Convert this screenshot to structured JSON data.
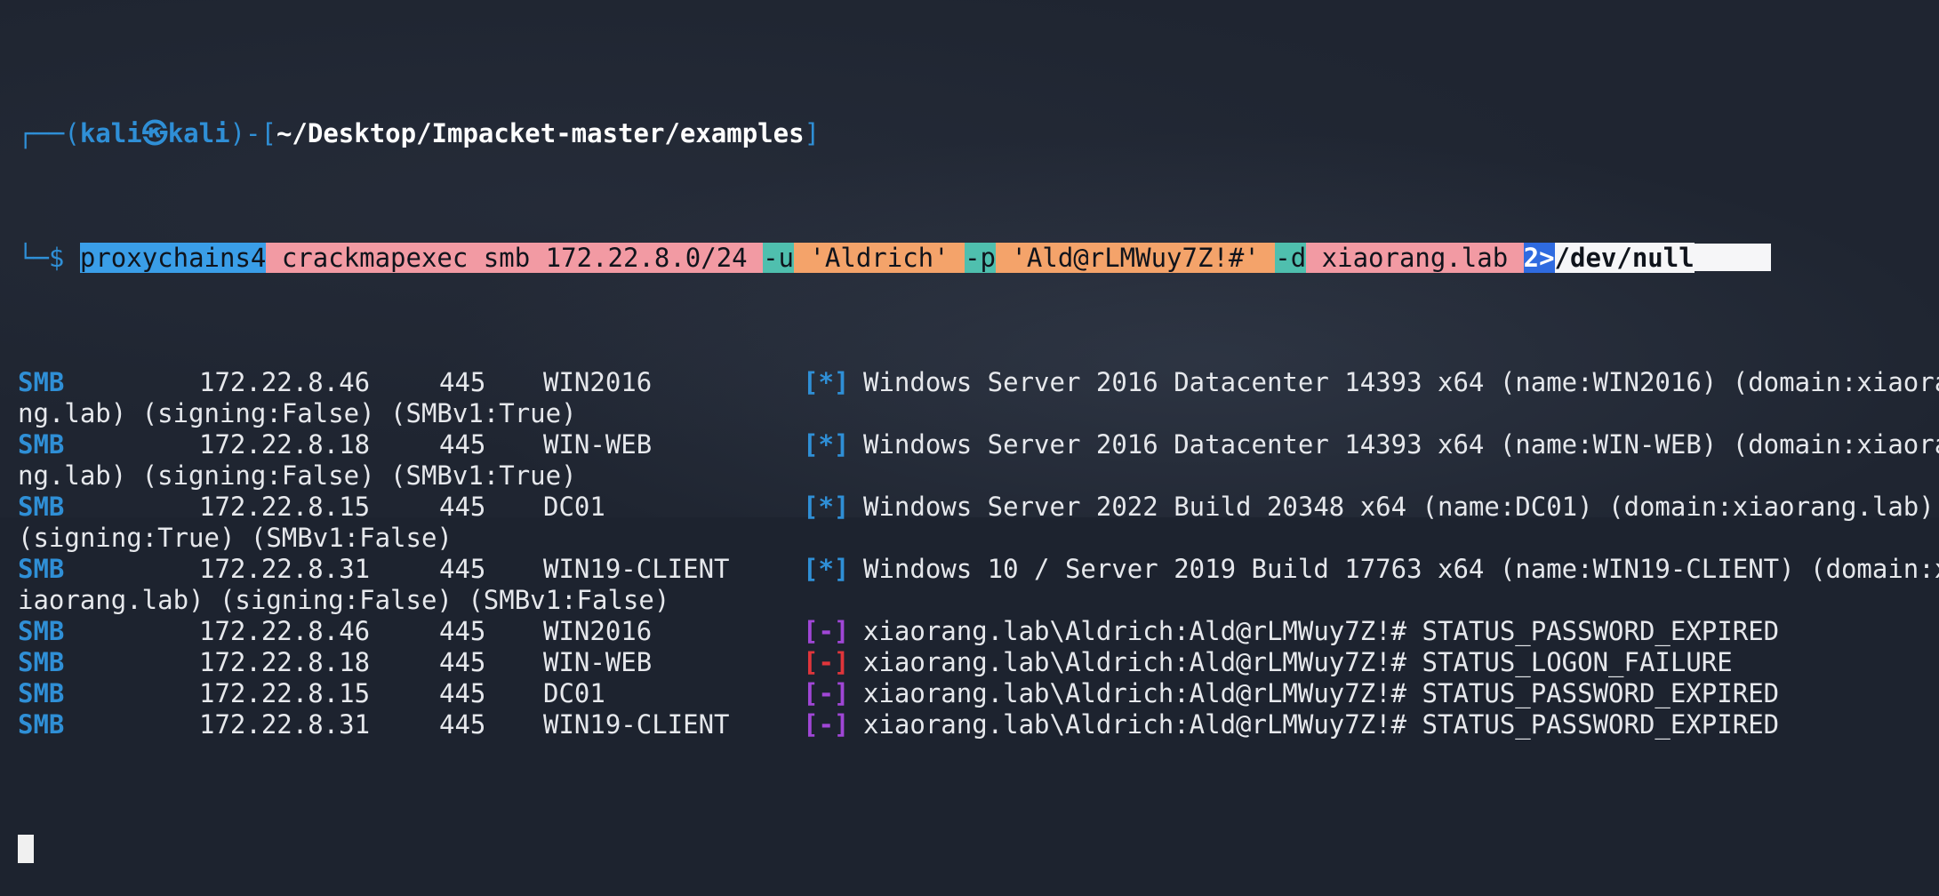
{
  "prompt": {
    "frame_left": "┌──(",
    "user": "kali",
    "at_glyph": "㉿",
    "host": "kali",
    "frame_mid": ")-[",
    "cwd": "~/Desktop/Impacket-master/examples",
    "frame_right": "]",
    "frame_bottom": "└─",
    "dollar": "$"
  },
  "command": {
    "cmd": "proxychains4",
    "arg1": " crackmapexec smb 172.22.8.0/24 ",
    "flag_u": "-u",
    "user_val": " 'Aldrich' ",
    "flag_p": "-p",
    "pass_val": " 'Ald@rLMWuy7Z!#' ",
    "flag_d": "-d",
    "domain_val": " xiaorang.lab ",
    "redir": "2>",
    "devnull": "/dev/null"
  },
  "output": [
    {
      "proto": "SMB",
      "ip": "172.22.8.46",
      "port": "445",
      "host": "WIN2016",
      "tag": "[*]",
      "tag_color": "blue",
      "text": "Windows Server 2016 Datacenter 14393 x64 (name:WIN2016) (domain:xiaora",
      "wrap": "ng.lab) (signing:False) (SMBv1:True)"
    },
    {
      "proto": "SMB",
      "ip": "172.22.8.18",
      "port": "445",
      "host": "WIN-WEB",
      "tag": "[*]",
      "tag_color": "blue",
      "text": "Windows Server 2016 Datacenter 14393 x64 (name:WIN-WEB) (domain:xiaora",
      "wrap": "ng.lab) (signing:False) (SMBv1:True)"
    },
    {
      "proto": "SMB",
      "ip": "172.22.8.15",
      "port": "445",
      "host": "DC01",
      "tag": "[*]",
      "tag_color": "blue",
      "text": "Windows Server 2022 Build 20348 x64 (name:DC01) (domain:xiaorang.lab)",
      "wrap": "(signing:True) (SMBv1:False)"
    },
    {
      "proto": "SMB",
      "ip": "172.22.8.31",
      "port": "445",
      "host": "WIN19-CLIENT",
      "tag": "[*]",
      "tag_color": "blue",
      "text": "Windows 10 / Server 2019 Build 17763 x64 (name:WIN19-CLIENT) (domain:x",
      "wrap": "iaorang.lab) (signing:False) (SMBv1:False)"
    },
    {
      "proto": "SMB",
      "ip": "172.22.8.46",
      "port": "445",
      "host": "WIN2016",
      "tag": "[-]",
      "tag_color": "purple",
      "text": "xiaorang.lab\\Aldrich:Ald@rLMWuy7Z!# STATUS_PASSWORD_EXPIRED"
    },
    {
      "proto": "SMB",
      "ip": "172.22.8.18",
      "port": "445",
      "host": "WIN-WEB",
      "tag": "[-]",
      "tag_color": "red",
      "text": "xiaorang.lab\\Aldrich:Ald@rLMWuy7Z!# STATUS_LOGON_FAILURE"
    },
    {
      "proto": "SMB",
      "ip": "172.22.8.15",
      "port": "445",
      "host": "DC01",
      "tag": "[-]",
      "tag_color": "purple",
      "text": "xiaorang.lab\\Aldrich:Ald@rLMWuy7Z!# STATUS_PASSWORD_EXPIRED"
    },
    {
      "proto": "SMB",
      "ip": "172.22.8.31",
      "port": "445",
      "host": "WIN19-CLIENT",
      "tag": "[-]",
      "tag_color": "purple",
      "text": "xiaorang.lab\\Aldrich:Ald@rLMWuy7Z!# STATUS_PASSWORD_EXPIRED"
    }
  ],
  "colors": {
    "background": "#1f2531",
    "prompt_blue": "#2f8fd6",
    "tag_purple": "#a046d6",
    "tag_red": "#e0353b"
  }
}
